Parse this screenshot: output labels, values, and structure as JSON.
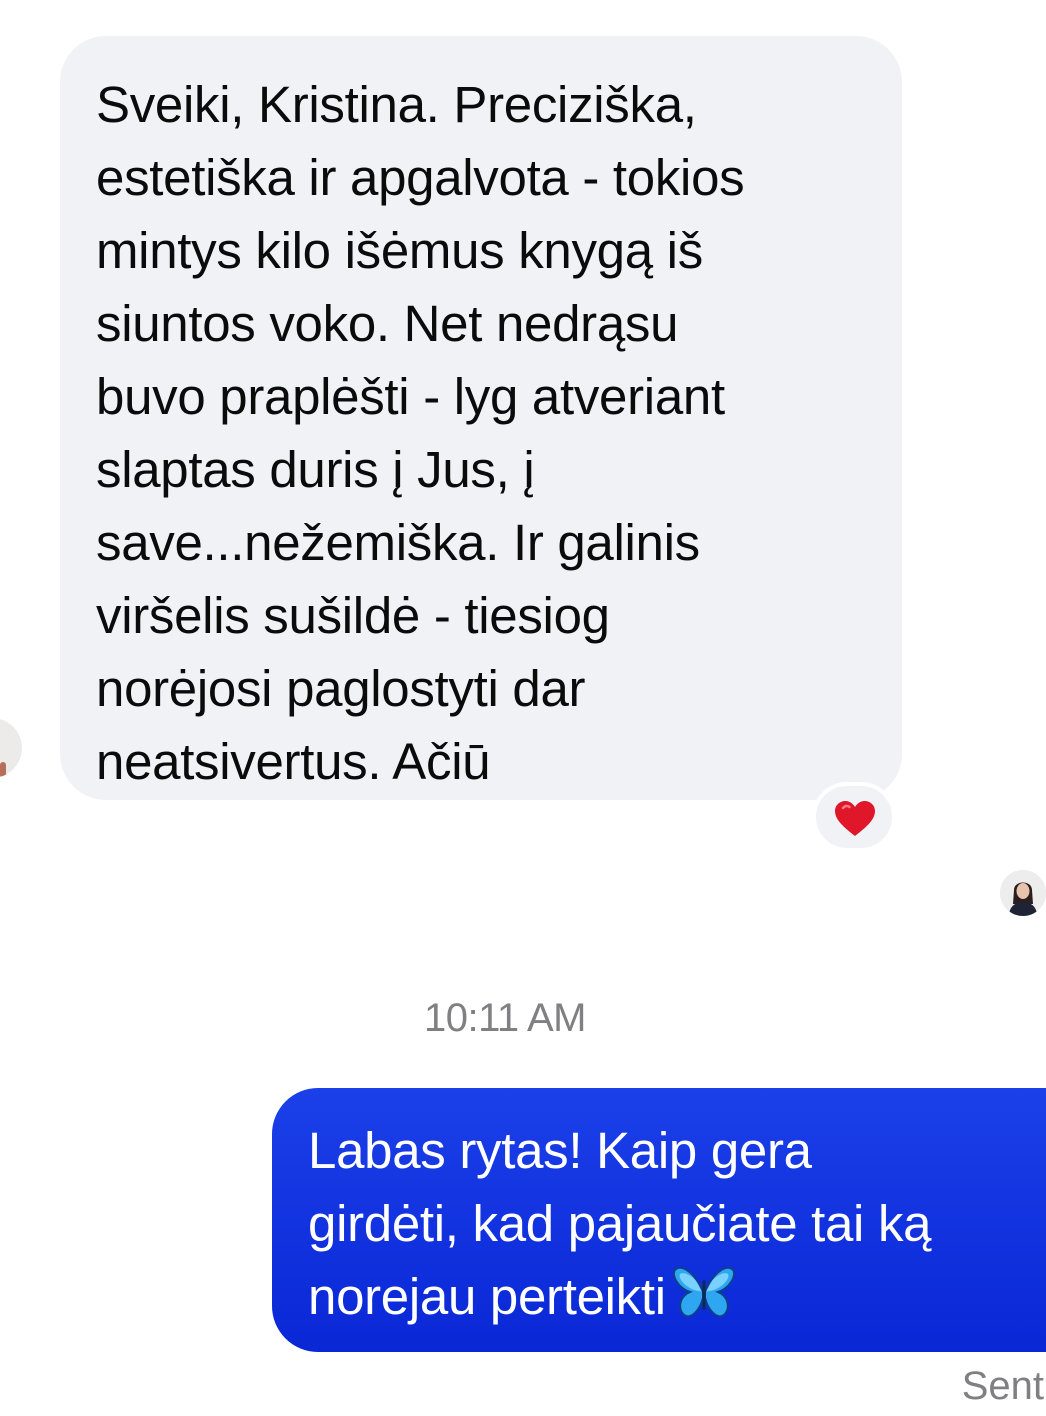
{
  "conversation": {
    "incoming_message": {
      "text": "Sveiki, Kristina. Preciziška,\nestetiška ir apgalvota - tokios\nmintys kilo išėmus knygą iš\nsiuntos voko. Net nedrąsu\nbuvo praplėšti - lyg atveriant\nslaptas duris į Jus, į\nsave...nežemiška. Ir galinis\nviršelis sušildė - tiesiog\nnorėjosi paglostyti dar\nneatsivertus. Ačiū",
      "reaction": "heart-icon"
    },
    "timestamp": "10:11 AM",
    "outgoing_message": {
      "text": "Labas rytas! Kaip gera\ngirdėti, kad pajaučiate tai ką\nnorejau perteikti",
      "emoji": "butterfly-icon"
    },
    "status": "Sent"
  },
  "colors": {
    "incoming_bubble": "#f1f2f6",
    "outgoing_bubble": "#0b28d8",
    "reaction_heart": "#e0172b",
    "meta_text": "#7f7f84"
  }
}
